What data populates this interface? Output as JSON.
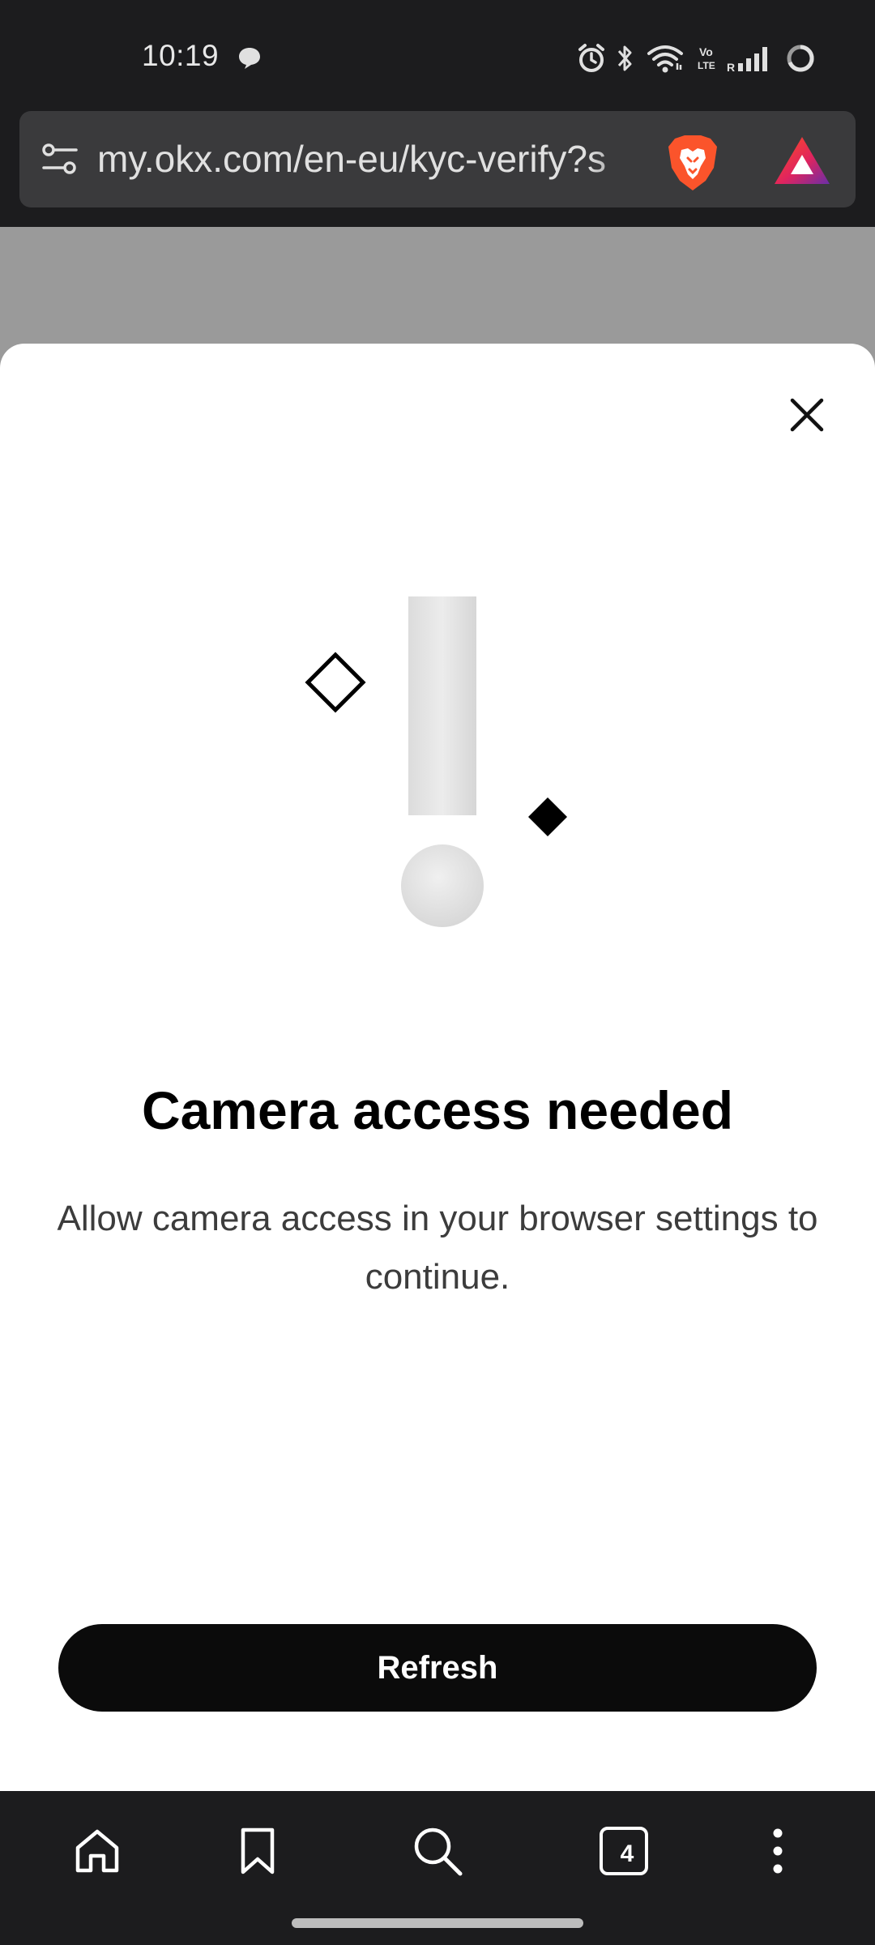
{
  "status_bar": {
    "time": "10:19",
    "icons": [
      "chat-bubble-icon",
      "alarm-icon",
      "bluetooth-icon",
      "wifi-icon",
      "volte-icon",
      "signal-icon",
      "battery-icon"
    ],
    "volte_text": "Vo LTE",
    "roaming_text": "R"
  },
  "url_bar": {
    "url": "my.okx.com/en-eu/kyc-verify?s",
    "icons": [
      "site-settings-icon",
      "brave-shields-icon",
      "brave-rewards-icon"
    ]
  },
  "dialog": {
    "title": "Camera access needed",
    "message": "Allow camera access in your browser settings to continue.",
    "refresh_label": "Refresh",
    "illustration": "exclamation-icon"
  },
  "bottom_bar": {
    "tab_count": "4",
    "icons": [
      "home-icon",
      "bookmark-icon",
      "search-icon",
      "tabs-icon",
      "more-menu-icon"
    ]
  },
  "colors": {
    "chrome_bg": "#1c1c1e",
    "url_bar_bg": "#3a3a3c",
    "backdrop": "#9a9a9a",
    "button_bg": "#0b0b0b",
    "brave_orange": "#fb542b"
  }
}
